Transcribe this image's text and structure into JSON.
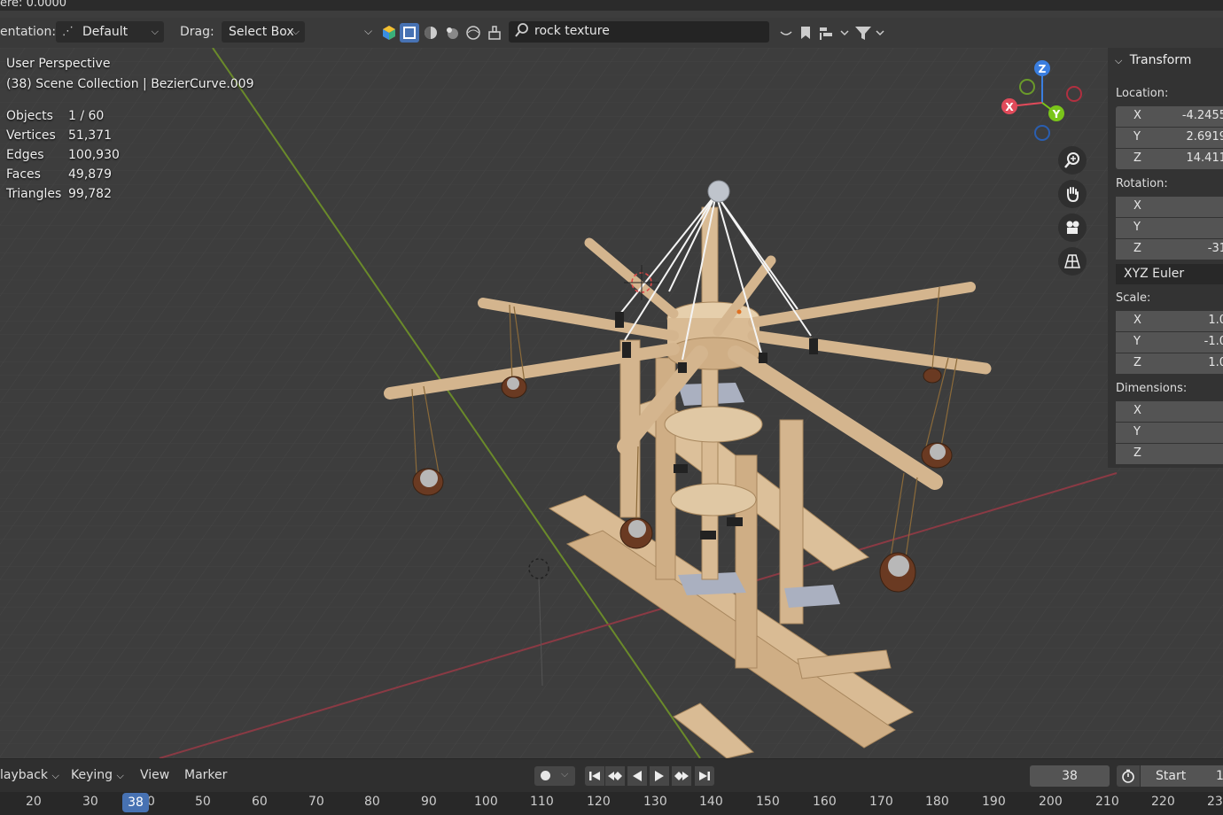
{
  "top_strip": {
    "text": "ere: 0.0000"
  },
  "header": {
    "orientation_label": "entation:",
    "orientation_value": "Default",
    "drag_label": "Drag:",
    "drag_value": "Select Box",
    "search_value": "rock texture"
  },
  "overlay": {
    "perspective": "User Perspective",
    "collection": "(38) Scene Collection | BezierCurve.009",
    "stats": [
      {
        "label": "Objects",
        "value": "1 / 60"
      },
      {
        "label": "Vertices",
        "value": "51,371"
      },
      {
        "label": "Edges",
        "value": "100,930"
      },
      {
        "label": "Faces",
        "value": "49,879"
      },
      {
        "label": "Triangles",
        "value": "99,782"
      }
    ]
  },
  "gizmo": {
    "x": "X",
    "y": "Y",
    "z": "Z"
  },
  "npanel": {
    "title": "Transform",
    "location_label": "Location:",
    "location": [
      {
        "axis": "X",
        "value": "-4.2455"
      },
      {
        "axis": "Y",
        "value": "2.6919"
      },
      {
        "axis": "Z",
        "value": "14.411"
      }
    ],
    "rotation_label": "Rotation:",
    "rotation": [
      {
        "axis": "X",
        "value": ""
      },
      {
        "axis": "Y",
        "value": ""
      },
      {
        "axis": "Z",
        "value": "-31"
      }
    ],
    "rotation_mode": "XYZ Euler",
    "scale_label": "Scale:",
    "scale": [
      {
        "axis": "X",
        "value": "1.0"
      },
      {
        "axis": "Y",
        "value": "-1.0"
      },
      {
        "axis": "Z",
        "value": "1.0"
      }
    ],
    "dimensions_label": "Dimensions:",
    "dimensions": [
      {
        "axis": "X",
        "value": ""
      },
      {
        "axis": "Y",
        "value": ""
      },
      {
        "axis": "Z",
        "value": ""
      }
    ]
  },
  "timeline": {
    "playback": "layback",
    "keying": "Keying",
    "view": "View",
    "marker": "Marker",
    "current_frame": "38",
    "start_label": "Start",
    "start_value": "1"
  },
  "ruler": {
    "ticks": [
      "20",
      "30",
      "0",
      "50",
      "60",
      "70",
      "80",
      "90",
      "100",
      "110",
      "120",
      "130",
      "140",
      "150",
      "160",
      "170",
      "180",
      "190",
      "200",
      "210",
      "220",
      "23"
    ],
    "current": "38"
  },
  "colors": {
    "axis_x": "#e04a5a",
    "axis_y": "#7ac51a",
    "axis_z": "#3a7ee0",
    "accent": "#4772b3",
    "wood": "#d4b58e"
  }
}
